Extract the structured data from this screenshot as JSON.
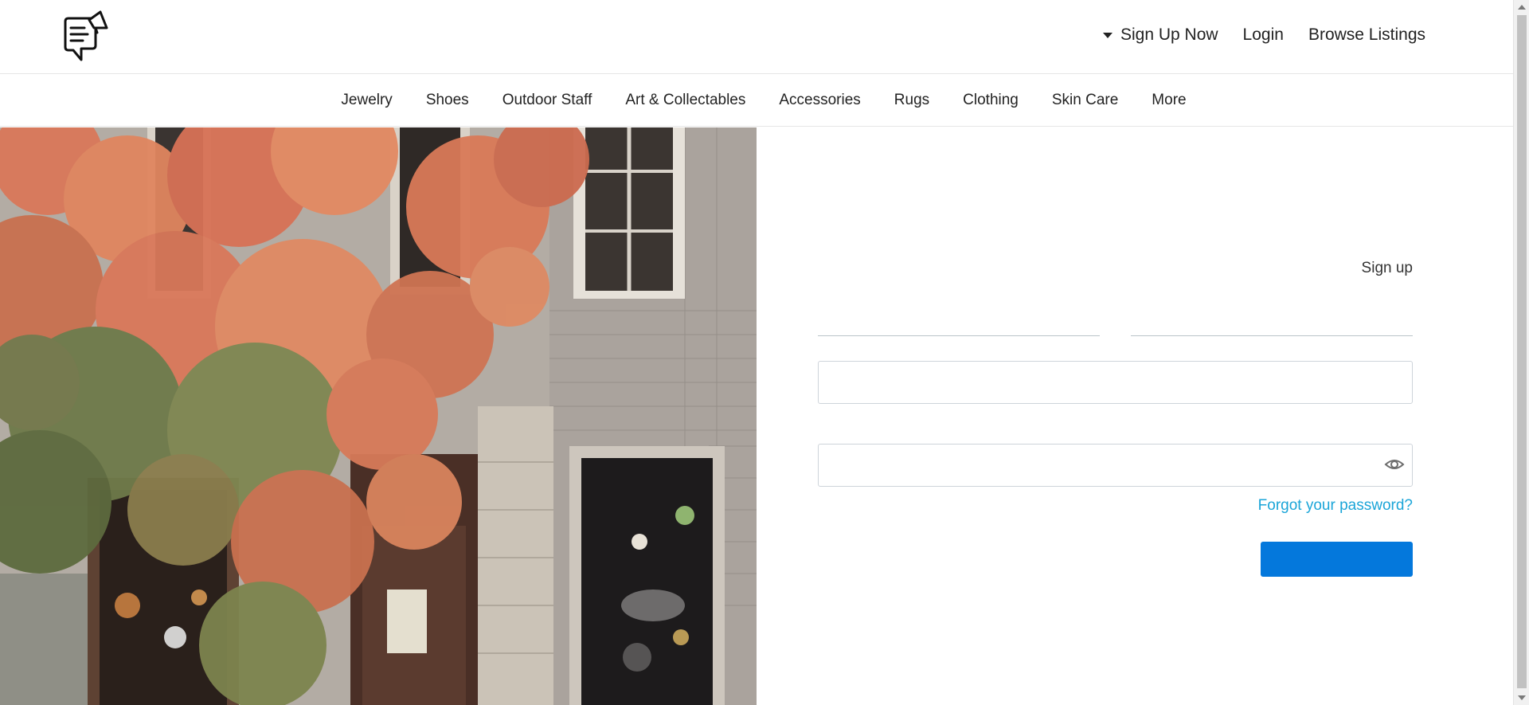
{
  "logo": {
    "icon": "chat-megaphone-logo-icon"
  },
  "top_nav": {
    "signup_label": "Sign Up Now",
    "login_label": "Login",
    "browse_label": "Browse Listings"
  },
  "categories": [
    "Jewelry",
    "Shoes",
    "Outdoor Staff",
    "Art & Collectables",
    "Accessories",
    "Rugs",
    "Clothing",
    "Skin Care",
    "More"
  ],
  "hero": {
    "image": "ivy-covered-storefront-photo"
  },
  "form": {
    "signup_link": "Sign up",
    "first_field_value": "",
    "second_field_value": "",
    "email_value": "",
    "password_value": "",
    "password_toggle_icon": "eye-icon",
    "forgot_label": "Forgot your password?",
    "submit_label": ""
  },
  "colors": {
    "accent_button": "#0478dc",
    "link": "#1ba5d8",
    "foliage_orange": "#d9785a",
    "foliage_green": "#6e7a4a"
  }
}
